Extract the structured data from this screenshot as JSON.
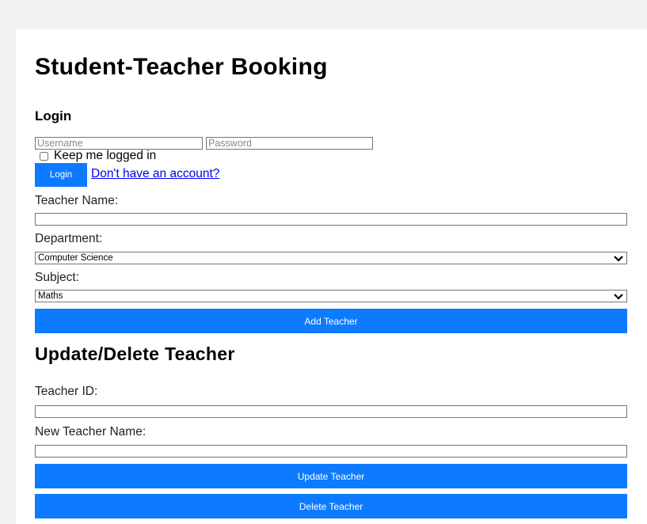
{
  "app": {
    "title": "Student-Teacher Booking"
  },
  "login": {
    "title": "Login",
    "username_placeholder": "Username",
    "password_placeholder": "Password",
    "keep_logged_in_label": "Keep me logged in",
    "login_button": "Login",
    "signup_link": "Don't have an account?"
  },
  "add_teacher": {
    "teacher_name_label": "Teacher Name:",
    "department_label": "Department:",
    "department_selected": "Computer Science",
    "subject_label": "Subject:",
    "subject_selected": "Maths",
    "add_button": "Add Teacher"
  },
  "update_delete": {
    "title": "Update/Delete Teacher",
    "teacher_id_label": "Teacher ID:",
    "new_name_label": "New Teacher Name:",
    "update_button": "Update Teacher",
    "delete_button": "Delete Teacher"
  },
  "colors": {
    "accent": "#0d7bff",
    "link": "#0000ee",
    "page_background": "#f2f2f2"
  }
}
